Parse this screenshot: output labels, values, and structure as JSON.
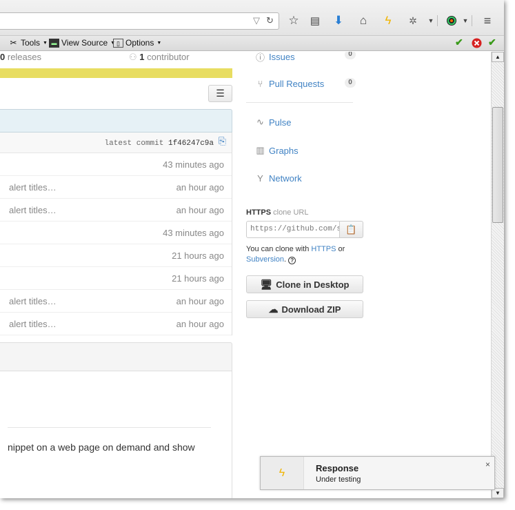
{
  "browser": {
    "toolbar_icons": [
      "dropdown-icon",
      "reload-icon",
      "bookmark-star-icon",
      "reading-list-icon",
      "download-icon",
      "home-icon",
      "lightning-icon",
      "firebug-icon",
      "menu-caret-icon",
      "color-wheel-icon",
      "hamburger-menu-icon"
    ],
    "addon_bar": {
      "tools_label": "Tools",
      "view_source_label": "View Source",
      "options_label": "Options",
      "status_icons": [
        "green-check-icon",
        "red-error-icon",
        "green-check-icon"
      ]
    }
  },
  "repo": {
    "releases_count": "0",
    "releases_label": "releases",
    "contributor_count": "1",
    "contributor_label": "contributor",
    "latest_commit_label": "latest commit",
    "latest_commit_sha": "1f46247c9a",
    "file_rows": [
      {
        "message": "",
        "age": "43 minutes ago"
      },
      {
        "message": "alert titles…",
        "age": "an hour ago"
      },
      {
        "message": "alert titles…",
        "age": "an hour ago"
      },
      {
        "message": "",
        "age": "43 minutes ago"
      },
      {
        "message": "",
        "age": "21 hours ago"
      },
      {
        "message": "",
        "age": "21 hours ago"
      },
      {
        "message": "alert titles…",
        "age": "an hour ago"
      },
      {
        "message": "alert titles…",
        "age": "an hour ago"
      }
    ],
    "readme_text": "nippet on a web page on demand and show"
  },
  "sidebar": {
    "issues": {
      "label": "Issues",
      "count": "0"
    },
    "pull_requests": {
      "label": "Pull Requests",
      "count": "0"
    },
    "pulse": "Pulse",
    "graphs": "Graphs",
    "network": "Network",
    "clone": {
      "protocol": "HTTPS",
      "label": "clone URL",
      "url": "https://github.com/su",
      "help_prefix": "You can clone with",
      "https_link": "HTTPS",
      "or": "or",
      "subversion_link": "Subversion",
      "period": "."
    },
    "clone_desktop": "Clone in Desktop",
    "download_zip": "Download ZIP"
  },
  "notification": {
    "title": "Response",
    "subtitle": "Under testing",
    "close": "×"
  }
}
